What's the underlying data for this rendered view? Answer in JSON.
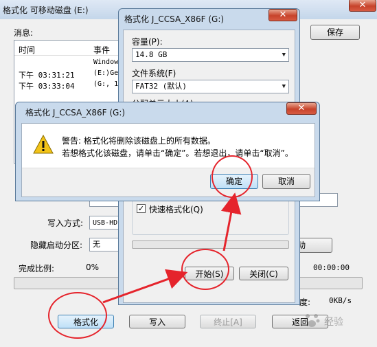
{
  "main_window": {
    "title": "格式化 可移动磁盘 (E:)",
    "messages_label": "消息:",
    "save_button": "保存",
    "log_columns": [
      "时间",
      "事件"
    ],
    "log_rows": [
      {
        "time": "",
        "event": "Window"
      },
      {
        "time": "下午 03:31:21",
        "event": "(E:)Ge"
      },
      {
        "time": "下午 03:33:04",
        "event": "(G:, 1"
      }
    ],
    "write_mode_label": "写入方式:",
    "write_mode_value": "USB-HD",
    "hidden_partition_label": "隐藏启动分区:",
    "hidden_partition_value": "无",
    "boot_button_partial": "动",
    "progress_label": "完成比例:",
    "progress_value": "0%",
    "elapsed_time": "00:00:00",
    "speed_partial_label": "度:",
    "speed_value": "0KB/s",
    "buttons": {
      "format": "格式化",
      "write": "写入",
      "stop": "终止[A]",
      "return_partial": "返回"
    }
  },
  "format_dialog": {
    "title": "格式化 J_CCSA_X86F (G:)",
    "capacity_label": "容量(P):",
    "capacity_value": "14.8 GB",
    "filesystem_label": "文件系统(F)",
    "filesystem_value": "FAT32 (默认)",
    "allocation_label": "分配单元大小(A)",
    "quick_format_label": "快速格式化(Q)",
    "quick_format_checked": true,
    "progress": 0,
    "start_button": "开始(S)",
    "close_button": "关闭(C)"
  },
  "warning_dialog": {
    "title": "格式化 J_CCSA_X86F (G:)",
    "line1": "警告: 格式化将删除该磁盘上的所有数据。",
    "line2": "若想格式化该磁盘，请单击“确定”。若想退出，请单击“取消”。",
    "ok_button": "确定",
    "cancel_button": "取消"
  },
  "watermark": "经验",
  "colors": {
    "annotation": "#e5242c",
    "accent": "#3c7fb1"
  }
}
